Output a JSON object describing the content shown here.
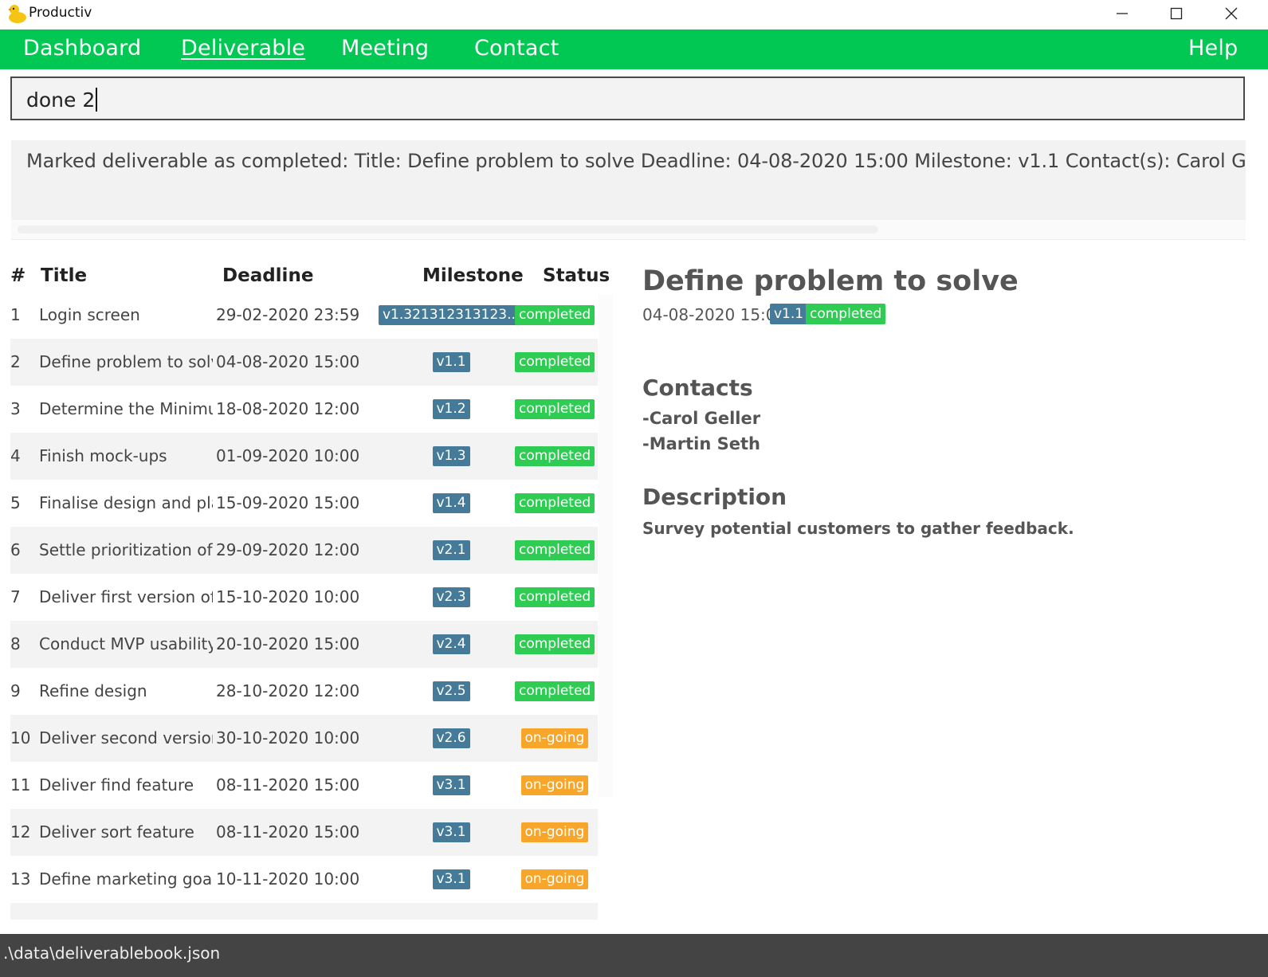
{
  "window": {
    "title": "Productiv",
    "app_icon": "duck-icon",
    "controls": [
      "minimize-icon",
      "maximize-icon",
      "close-icon"
    ]
  },
  "menu": {
    "items": [
      "Dashboard",
      "Deliverable",
      "Meeting",
      "Contact"
    ],
    "active": "Deliverable",
    "help": "Help"
  },
  "command": {
    "value": "done 2"
  },
  "result": {
    "text": "Marked deliverable as completed: Title: Define problem to solve Deadline: 04-08-2020 15:00 Milestone: v1.1 Contact(s): Carol Geller, Martin Seth"
  },
  "table": {
    "headers": {
      "index": "#",
      "title": "Title",
      "deadline": "Deadline",
      "milestone": "Milestone",
      "status": "Status"
    },
    "rows": [
      {
        "index": "1",
        "title": "Login screen",
        "deadline": "29-02-2020 23:59",
        "milestone": "v1.321312313123...",
        "status": "completed"
      },
      {
        "index": "2",
        "title": "Define problem to solve",
        "deadline": "04-08-2020 15:00",
        "milestone": "v1.1",
        "status": "completed"
      },
      {
        "index": "3",
        "title": "Determine the Minimu...",
        "deadline": "18-08-2020 12:00",
        "milestone": "v1.2",
        "status": "completed"
      },
      {
        "index": "4",
        "title": "Finish mock-ups",
        "deadline": "01-09-2020 10:00",
        "milestone": "v1.3",
        "status": "completed"
      },
      {
        "index": "5",
        "title": "Finalise design and plan",
        "deadline": "15-09-2020 15:00",
        "milestone": "v1.4",
        "status": "completed"
      },
      {
        "index": "6",
        "title": "Settle prioritization of fe...",
        "deadline": "29-09-2020 12:00",
        "milestone": "v2.1",
        "status": "completed"
      },
      {
        "index": "7",
        "title": "Deliver first version of ...",
        "deadline": "15-10-2020 10:00",
        "milestone": "v2.3",
        "status": "completed"
      },
      {
        "index": "8",
        "title": "Conduct MVP usability t...",
        "deadline": "20-10-2020 15:00",
        "milestone": "v2.4",
        "status": "completed"
      },
      {
        "index": "9",
        "title": "Refine design",
        "deadline": "28-10-2020 12:00",
        "milestone": "v2.5",
        "status": "completed"
      },
      {
        "index": "10",
        "title": "Deliver second version ...",
        "deadline": "30-10-2020 10:00",
        "milestone": "v2.6",
        "status": "on-going"
      },
      {
        "index": "11",
        "title": "Deliver find feature",
        "deadline": "08-11-2020 15:00",
        "milestone": "v3.1",
        "status": "on-going"
      },
      {
        "index": "12",
        "title": "Deliver sort feature",
        "deadline": "08-11-2020 15:00",
        "milestone": "v3.1",
        "status": "on-going"
      },
      {
        "index": "13",
        "title": "Define marketing goals",
        "deadline": "10-11-2020 10:00",
        "milestone": "v3.1",
        "status": "on-going"
      }
    ]
  },
  "detail": {
    "title": "Define problem to solve",
    "deadline": "04-08-2020 15:00",
    "milestone": "v1.1",
    "status": "completed",
    "contacts_heading": "Contacts",
    "contacts": [
      "-Carol Geller",
      "-Martin Seth"
    ],
    "description_heading": "Description",
    "description": "Survey potential customers to gather feedback."
  },
  "statusbar": {
    "path": ".\\data\\deliverablebook.json"
  },
  "colors": {
    "menu_bar": "#00c853",
    "milestone_badge": "#457b98",
    "completed_badge": "#2ecc52",
    "ongoing_badge": "#f7a62a",
    "status_bar": "#444444"
  }
}
